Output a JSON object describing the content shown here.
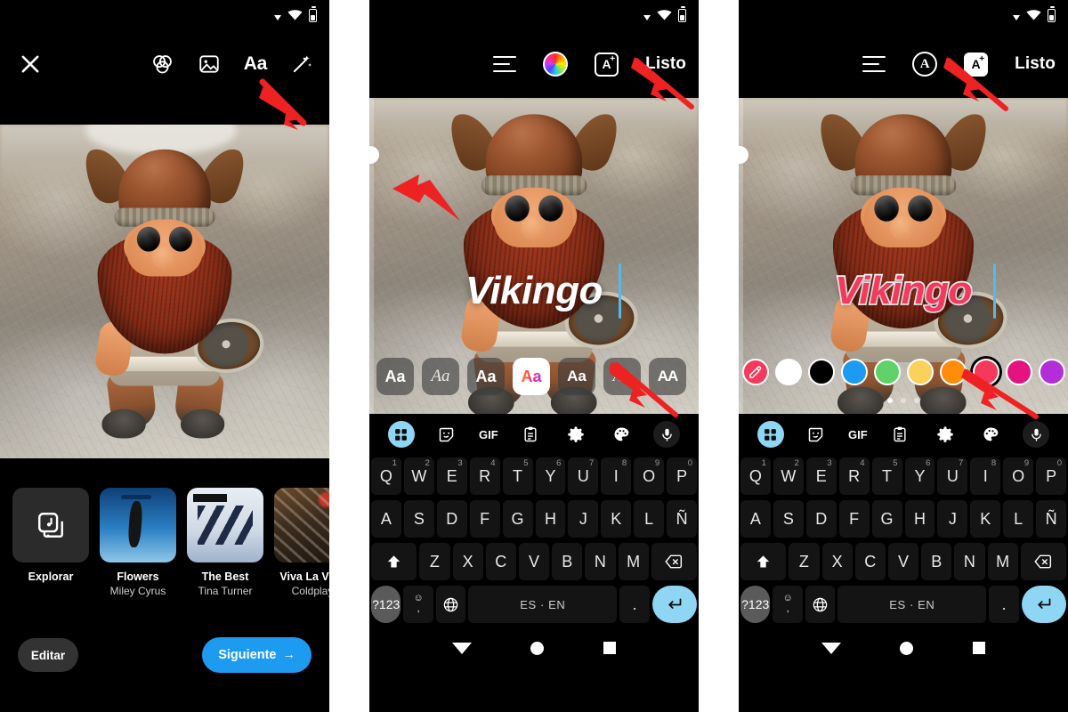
{
  "app": {
    "accent_blue": "#1d9bf0",
    "keyboard_accent": "#8fd5f4",
    "text_pink": "#f5385b",
    "annotation_arrow_color": "#ee2222"
  },
  "status_bar": {
    "icons": [
      "dropdown-triangle-icon",
      "wifi-icon",
      "battery-icon"
    ]
  },
  "panel1": {
    "topbar": {
      "close_label": "✕",
      "icons": [
        "close-icon",
        "filters-icon",
        "image-icon",
        "text-icon",
        "magic-wand-icon"
      ],
      "text_tool_label": "Aa"
    },
    "photo": {
      "alt": "viking-figurine-photo"
    },
    "music": {
      "cards": [
        {
          "title": "Explorar",
          "artist": "",
          "art": "explore",
          "icon": "music-library-icon"
        },
        {
          "title": "Flowers",
          "artist": "Miley Cyrus",
          "art": "flowers"
        },
        {
          "title": "The Best",
          "artist": "Tina Turner",
          "art": "best"
        },
        {
          "title": "Viva La Vida",
          "artist": "Coldplay",
          "art": "viva"
        },
        {
          "title": "",
          "artist": "",
          "art": "extra"
        }
      ]
    },
    "actions": {
      "edit_label": "Editar",
      "next_label": "Siguiente",
      "next_arrow": "→"
    }
  },
  "panel2": {
    "topbar": {
      "align_label": "align-icon",
      "color_label": "color-wheel-icon",
      "effects_label": "A",
      "effects_plus": "+",
      "done_label": "Listo"
    },
    "overlay": {
      "text": "Vikingo",
      "color": "#ffffff",
      "style": "bold-italic"
    },
    "fonts": [
      {
        "label": "Aa",
        "style": "bold",
        "selected": false
      },
      {
        "label": "Aa",
        "style": "script",
        "selected": false
      },
      {
        "label": "Aa",
        "style": "bold",
        "selected": false
      },
      {
        "label": "Aa",
        "style": "gradient",
        "selected": true
      },
      {
        "label": "Aa",
        "style": "round",
        "selected": false
      },
      {
        "label": "Aa",
        "style": "serif",
        "selected": false
      },
      {
        "label": "AA",
        "style": "wide",
        "selected": false
      }
    ],
    "keyboard": {
      "tools": [
        "apps-icon",
        "sticker-icon",
        "gif-icon",
        "clipboard-icon",
        "settings-icon",
        "theme-icon",
        "mic-icon"
      ],
      "gif_label": "GIF",
      "row1": [
        {
          "k": "Q",
          "n": "1"
        },
        {
          "k": "W",
          "n": "2"
        },
        {
          "k": "E",
          "n": "3"
        },
        {
          "k": "R",
          "n": "4"
        },
        {
          "k": "T",
          "n": "5"
        },
        {
          "k": "Y",
          "n": "6"
        },
        {
          "k": "U",
          "n": "7"
        },
        {
          "k": "I",
          "n": "8"
        },
        {
          "k": "O",
          "n": "9"
        },
        {
          "k": "P",
          "n": "0"
        }
      ],
      "row2": [
        "A",
        "S",
        "D",
        "F",
        "G",
        "H",
        "J",
        "K",
        "L",
        "Ñ"
      ],
      "row3": [
        "Z",
        "X",
        "C",
        "V",
        "B",
        "N",
        "M"
      ],
      "shift_label": "⬆",
      "backspace_label": "⌫",
      "sym_label": "?123",
      "emoji_label": "☺",
      "comma_label": ",",
      "globe_label": "⊕",
      "space_label": "ES · EN",
      "period_label": ".",
      "enter_label": "↵"
    },
    "navbar": [
      "back-icon",
      "home-icon",
      "recents-icon"
    ]
  },
  "panel3": {
    "topbar": {
      "align_label": "align-icon",
      "outline_label": "A",
      "effects_label": "A",
      "effects_plus": "+",
      "done_label": "Listo"
    },
    "overlay": {
      "text": "Vikingo",
      "color": "#f5385b",
      "outline": "#ffffff",
      "style": "bold-italic-outlined"
    },
    "colors": [
      {
        "name": "eyedropper",
        "hex": "#f5385b",
        "selected": false,
        "is_tool": true
      },
      {
        "name": "white",
        "hex": "#ffffff",
        "selected": false
      },
      {
        "name": "black",
        "hex": "#000000",
        "selected": false
      },
      {
        "name": "blue",
        "hex": "#1d9bf0",
        "selected": false
      },
      {
        "name": "green",
        "hex": "#5fd36a",
        "selected": false
      },
      {
        "name": "yellow",
        "hex": "#fbd05b",
        "selected": false
      },
      {
        "name": "orange",
        "hex": "#ff8c0a",
        "selected": false
      },
      {
        "name": "pink",
        "hex": "#f5385b",
        "selected": true
      },
      {
        "name": "magenta",
        "hex": "#e4137f",
        "selected": false
      },
      {
        "name": "purple",
        "hex": "#b32dd8",
        "selected": false
      }
    ],
    "page_dots": {
      "count": 3,
      "active_index": 0
    }
  }
}
